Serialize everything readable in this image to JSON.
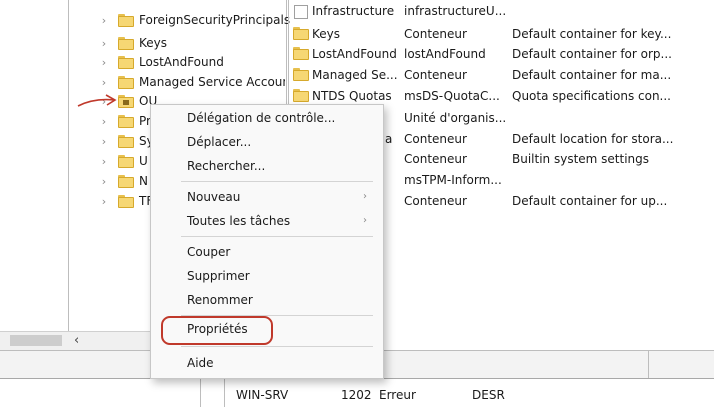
{
  "tree": {
    "items": [
      {
        "label": "ForeignSecurityPrincipals"
      },
      {
        "label": "Keys"
      },
      {
        "label": "LostAndFound"
      },
      {
        "label": "Managed Service Accoun"
      },
      {
        "label": "OU"
      },
      {
        "label": "Pr"
      },
      {
        "label": "Sy"
      },
      {
        "label": "U"
      },
      {
        "label": "N"
      },
      {
        "label": "TF"
      }
    ],
    "scroll_left_arrow": "‹"
  },
  "list": {
    "rows": [
      {
        "name": "Infrastructure",
        "type": "infrastructureU...",
        "desc": ""
      },
      {
        "name": "Keys",
        "type": "Conteneur",
        "desc": "Default container for key..."
      },
      {
        "name": "LostAndFound",
        "type": "lostAndFound",
        "desc": "Default container for orp..."
      },
      {
        "name": "Managed Se...",
        "type": "Conteneur",
        "desc": "Default container for ma..."
      },
      {
        "name": "NTDS Quotas",
        "type": "msDS-QuotaC...",
        "desc": "Quota specifications con..."
      },
      {
        "name": "",
        "type": "Unité d'organis...",
        "desc": ""
      },
      {
        "name": "a",
        "type": "Conteneur",
        "desc": "Default location for stora..."
      },
      {
        "name": "",
        "type": "Conteneur",
        "desc": "Builtin system settings"
      },
      {
        "name": "",
        "type": "msTPM-Inform...",
        "desc": ""
      },
      {
        "name": "",
        "type": "Conteneur",
        "desc": "Default container for up..."
      }
    ]
  },
  "context_menu": {
    "delegation": "Délégation de contrôle...",
    "deplacer": "Déplacer...",
    "rechercher": "Rechercher...",
    "nouveau": "Nouveau",
    "toutes_taches": "Toutes les tâches",
    "couper": "Couper",
    "supprimer": "Supprimer",
    "renommer": "Renommer",
    "proprietes": "Propriétés",
    "aide": "Aide",
    "submenu_arrow": "›"
  },
  "bottom_row": {
    "server": "WIN-SRV",
    "code": "1202",
    "level": "Erreur",
    "source": "DESR"
  },
  "annotation": {
    "arrow_color": "#c0392b",
    "oval_color": "#c0392b"
  },
  "icons": {
    "folder": "folder-icon",
    "ou": "organizational-unit-icon",
    "chevron": "chevron-right-icon",
    "arrow": "red-arrow-annotation"
  }
}
